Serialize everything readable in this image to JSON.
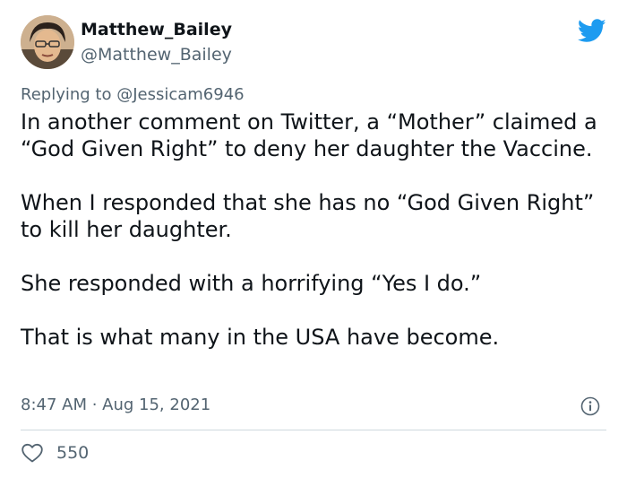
{
  "tweet": {
    "display_name": "Matthew_Bailey",
    "handle": "@Matthew_Bailey",
    "reply_prefix": "Replying to ",
    "reply_mention": "@Jessicam6946",
    "paragraphs": [
      "In another comment on Twitter, a “Mother” claimed a “God Given Right” to deny her daughter the Vaccine.",
      "When I responded that she has no “God Given Right” to kill her daughter.",
      "She responded with a horrifying “Yes I do.”",
      "That is what many in the USA have become."
    ],
    "timestamp": "8:47 AM · Aug 15, 2021",
    "likes": "550"
  },
  "icons": {
    "brand": "twitter-bird-icon",
    "info": "info-icon",
    "like": "heart-icon"
  },
  "colors": {
    "brand": "#1d9bf0",
    "text_primary": "#0f1419",
    "text_secondary": "#536471",
    "divider": "#cfd9de"
  }
}
